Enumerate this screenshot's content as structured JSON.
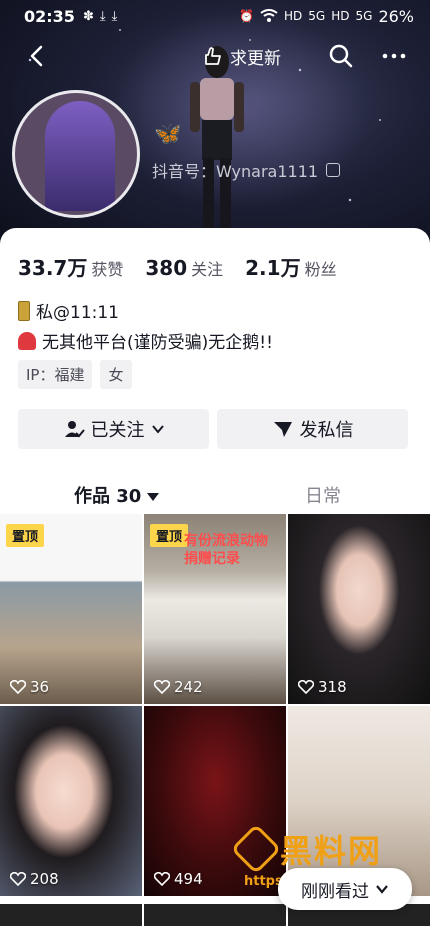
{
  "status_bar": {
    "time": "02:35",
    "left_icons": [
      "✽",
      "⤓",
      "⤓"
    ],
    "right_icons": [
      "⏰",
      "wifi",
      "HD",
      "5G",
      "HD",
      "5G"
    ],
    "battery": "26%"
  },
  "nav": {
    "update_label": "求更新"
  },
  "profile": {
    "douyin_id": "抖音号：Wynara1111",
    "butterfly": "🦋"
  },
  "stats": {
    "likes_num": "33.7万",
    "likes_lbl": "获赞",
    "following_num": "380",
    "following_lbl": "关注",
    "followers_num": "2.1万",
    "followers_lbl": "粉丝"
  },
  "bio": {
    "line1": "私@11:11",
    "line2": "无其他平台(谨防受骗)无企鹅!!"
  },
  "tags": {
    "ip": "IP：福建",
    "gender": "女"
  },
  "buttons": {
    "followed": "已关注",
    "message": "发私信"
  },
  "tabs": {
    "works": "作品 30",
    "daily": "日常"
  },
  "grid": [
    {
      "pin": "置顶",
      "likes": "36"
    },
    {
      "pin": "置顶",
      "caption_line1": "有份流浪动物",
      "caption_line2": "捐赠记录",
      "likes": "242"
    },
    {
      "likes": "318"
    },
    {
      "likes": "208"
    },
    {
      "likes": "494"
    },
    {
      "likes": ""
    }
  ],
  "recent_button": "刚刚看过",
  "watermark": {
    "name": "黑料网",
    "url": "https://hlwe2.com"
  },
  "colors": {
    "pin_bg": "#fdd54a",
    "watermark": "#f0a015",
    "card_bg": "#ffffff"
  }
}
